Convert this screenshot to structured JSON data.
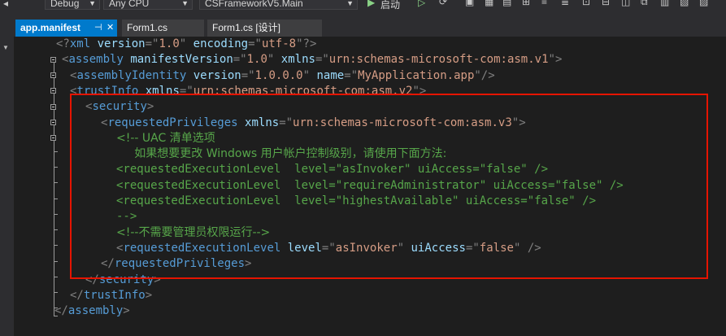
{
  "toolbar": {
    "config": "Debug",
    "platform": "Any CPU",
    "startup_project": "CSFrameworkV5.Main",
    "start_label": "启动"
  },
  "tabs": [
    {
      "label": "app.manifest",
      "active": true
    },
    {
      "label": "Form1.cs",
      "active": false
    },
    {
      "label": "Form1.cs [设计]",
      "active": false
    }
  ],
  "colors": {
    "bracket": "#808080",
    "tag": "#569cd6",
    "attr": "#9cdcfe",
    "value": "#d69d85",
    "comment": "#57a64a",
    "highlight_box": "#e51400",
    "tab_active": "#007acc"
  },
  "code": [
    [
      [
        "b",
        "<?"
      ],
      [
        "t",
        "xml"
      ],
      [
        "p",
        " "
      ],
      [
        "a",
        "version"
      ],
      [
        "b",
        "=\""
      ],
      [
        "v",
        "1.0"
      ],
      [
        "b",
        "\""
      ],
      [
        "p",
        " "
      ],
      [
        "a",
        "encoding"
      ],
      [
        "b",
        "=\""
      ],
      [
        "v",
        "utf-8"
      ],
      [
        "b",
        "\"?>"
      ]
    ],
    [
      [
        "b",
        "<"
      ],
      [
        "t",
        "assembly"
      ],
      [
        "p",
        " "
      ],
      [
        "a",
        "manifestVersion"
      ],
      [
        "b",
        "=\""
      ],
      [
        "v",
        "1.0"
      ],
      [
        "b",
        "\""
      ],
      [
        "p",
        " "
      ],
      [
        "a",
        "xmlns"
      ],
      [
        "b",
        "=\""
      ],
      [
        "v",
        "urn:schemas-microsoft-com:asm.v1"
      ],
      [
        "b",
        "\">"
      ]
    ],
    [
      [
        "b",
        "<"
      ],
      [
        "t",
        "assemblyIdentity"
      ],
      [
        "p",
        " "
      ],
      [
        "a",
        "version"
      ],
      [
        "b",
        "=\""
      ],
      [
        "v",
        "1.0.0.0"
      ],
      [
        "b",
        "\""
      ],
      [
        "p",
        " "
      ],
      [
        "a",
        "name"
      ],
      [
        "b",
        "=\""
      ],
      [
        "v",
        "MyApplication.app"
      ],
      [
        "b",
        "\"/>"
      ]
    ],
    [
      [
        "b",
        "<"
      ],
      [
        "t",
        "trustInfo"
      ],
      [
        "p",
        " "
      ],
      [
        "a",
        "xmlns"
      ],
      [
        "b",
        "=\""
      ],
      [
        "v",
        "urn:schemas-microsoft-com:asm.v2"
      ],
      [
        "b",
        "\">"
      ]
    ],
    [
      [
        "b",
        "<"
      ],
      [
        "t",
        "security"
      ],
      [
        "b",
        ">"
      ]
    ],
    [
      [
        "b",
        "<"
      ],
      [
        "t",
        "requestedPrivileges"
      ],
      [
        "p",
        " "
      ],
      [
        "a",
        "xmlns"
      ],
      [
        "b",
        "=\""
      ],
      [
        "v",
        "urn:schemas-microsoft-com:asm.v3"
      ],
      [
        "b",
        "\">"
      ]
    ],
    [
      [
        "c",
        "<!-- UAC 清单选项"
      ]
    ],
    [
      [
        "c",
        "     如果想要更改 Windows 用户帐户控制级别，请使用下面方法:"
      ]
    ],
    [
      [
        "cm",
        "<requestedExecutionLevel  level=\"asInvoker\" uiAccess=\"false\" />"
      ]
    ],
    [
      [
        "cm",
        "<requestedExecutionLevel  level=\"requireAdministrator\" uiAccess=\"false\" />"
      ]
    ],
    [
      [
        "cm",
        "<requestedExecutionLevel  level=\"highestAvailable\" uiAccess=\"false\" />"
      ]
    ],
    [
      [
        "cm",
        "-->"
      ]
    ],
    [
      [
        "c",
        "<!--不需要管理员权限运行-->"
      ]
    ],
    [
      [
        "b",
        "<"
      ],
      [
        "t",
        "requestedExecutionLevel"
      ],
      [
        "p",
        " "
      ],
      [
        "a",
        "level"
      ],
      [
        "b",
        "=\""
      ],
      [
        "v",
        "asInvoker"
      ],
      [
        "b",
        "\""
      ],
      [
        "p",
        " "
      ],
      [
        "a",
        "uiAccess"
      ],
      [
        "b",
        "=\""
      ],
      [
        "v",
        "false"
      ],
      [
        "b",
        "\""
      ],
      [
        "p",
        " "
      ],
      [
        "b",
        "/>"
      ]
    ],
    [
      [
        "b",
        "</"
      ],
      [
        "t",
        "requestedPrivileges"
      ],
      [
        "b",
        ">"
      ]
    ],
    [
      [
        "b",
        "</"
      ],
      [
        "t",
        "security"
      ],
      [
        "b",
        ">"
      ]
    ],
    [
      [
        "b",
        "</"
      ],
      [
        "t",
        "trustInfo"
      ],
      [
        "b",
        ">"
      ]
    ],
    [
      [
        "b",
        "</"
      ],
      [
        "t",
        "assembly"
      ],
      [
        "b",
        ">"
      ]
    ]
  ]
}
